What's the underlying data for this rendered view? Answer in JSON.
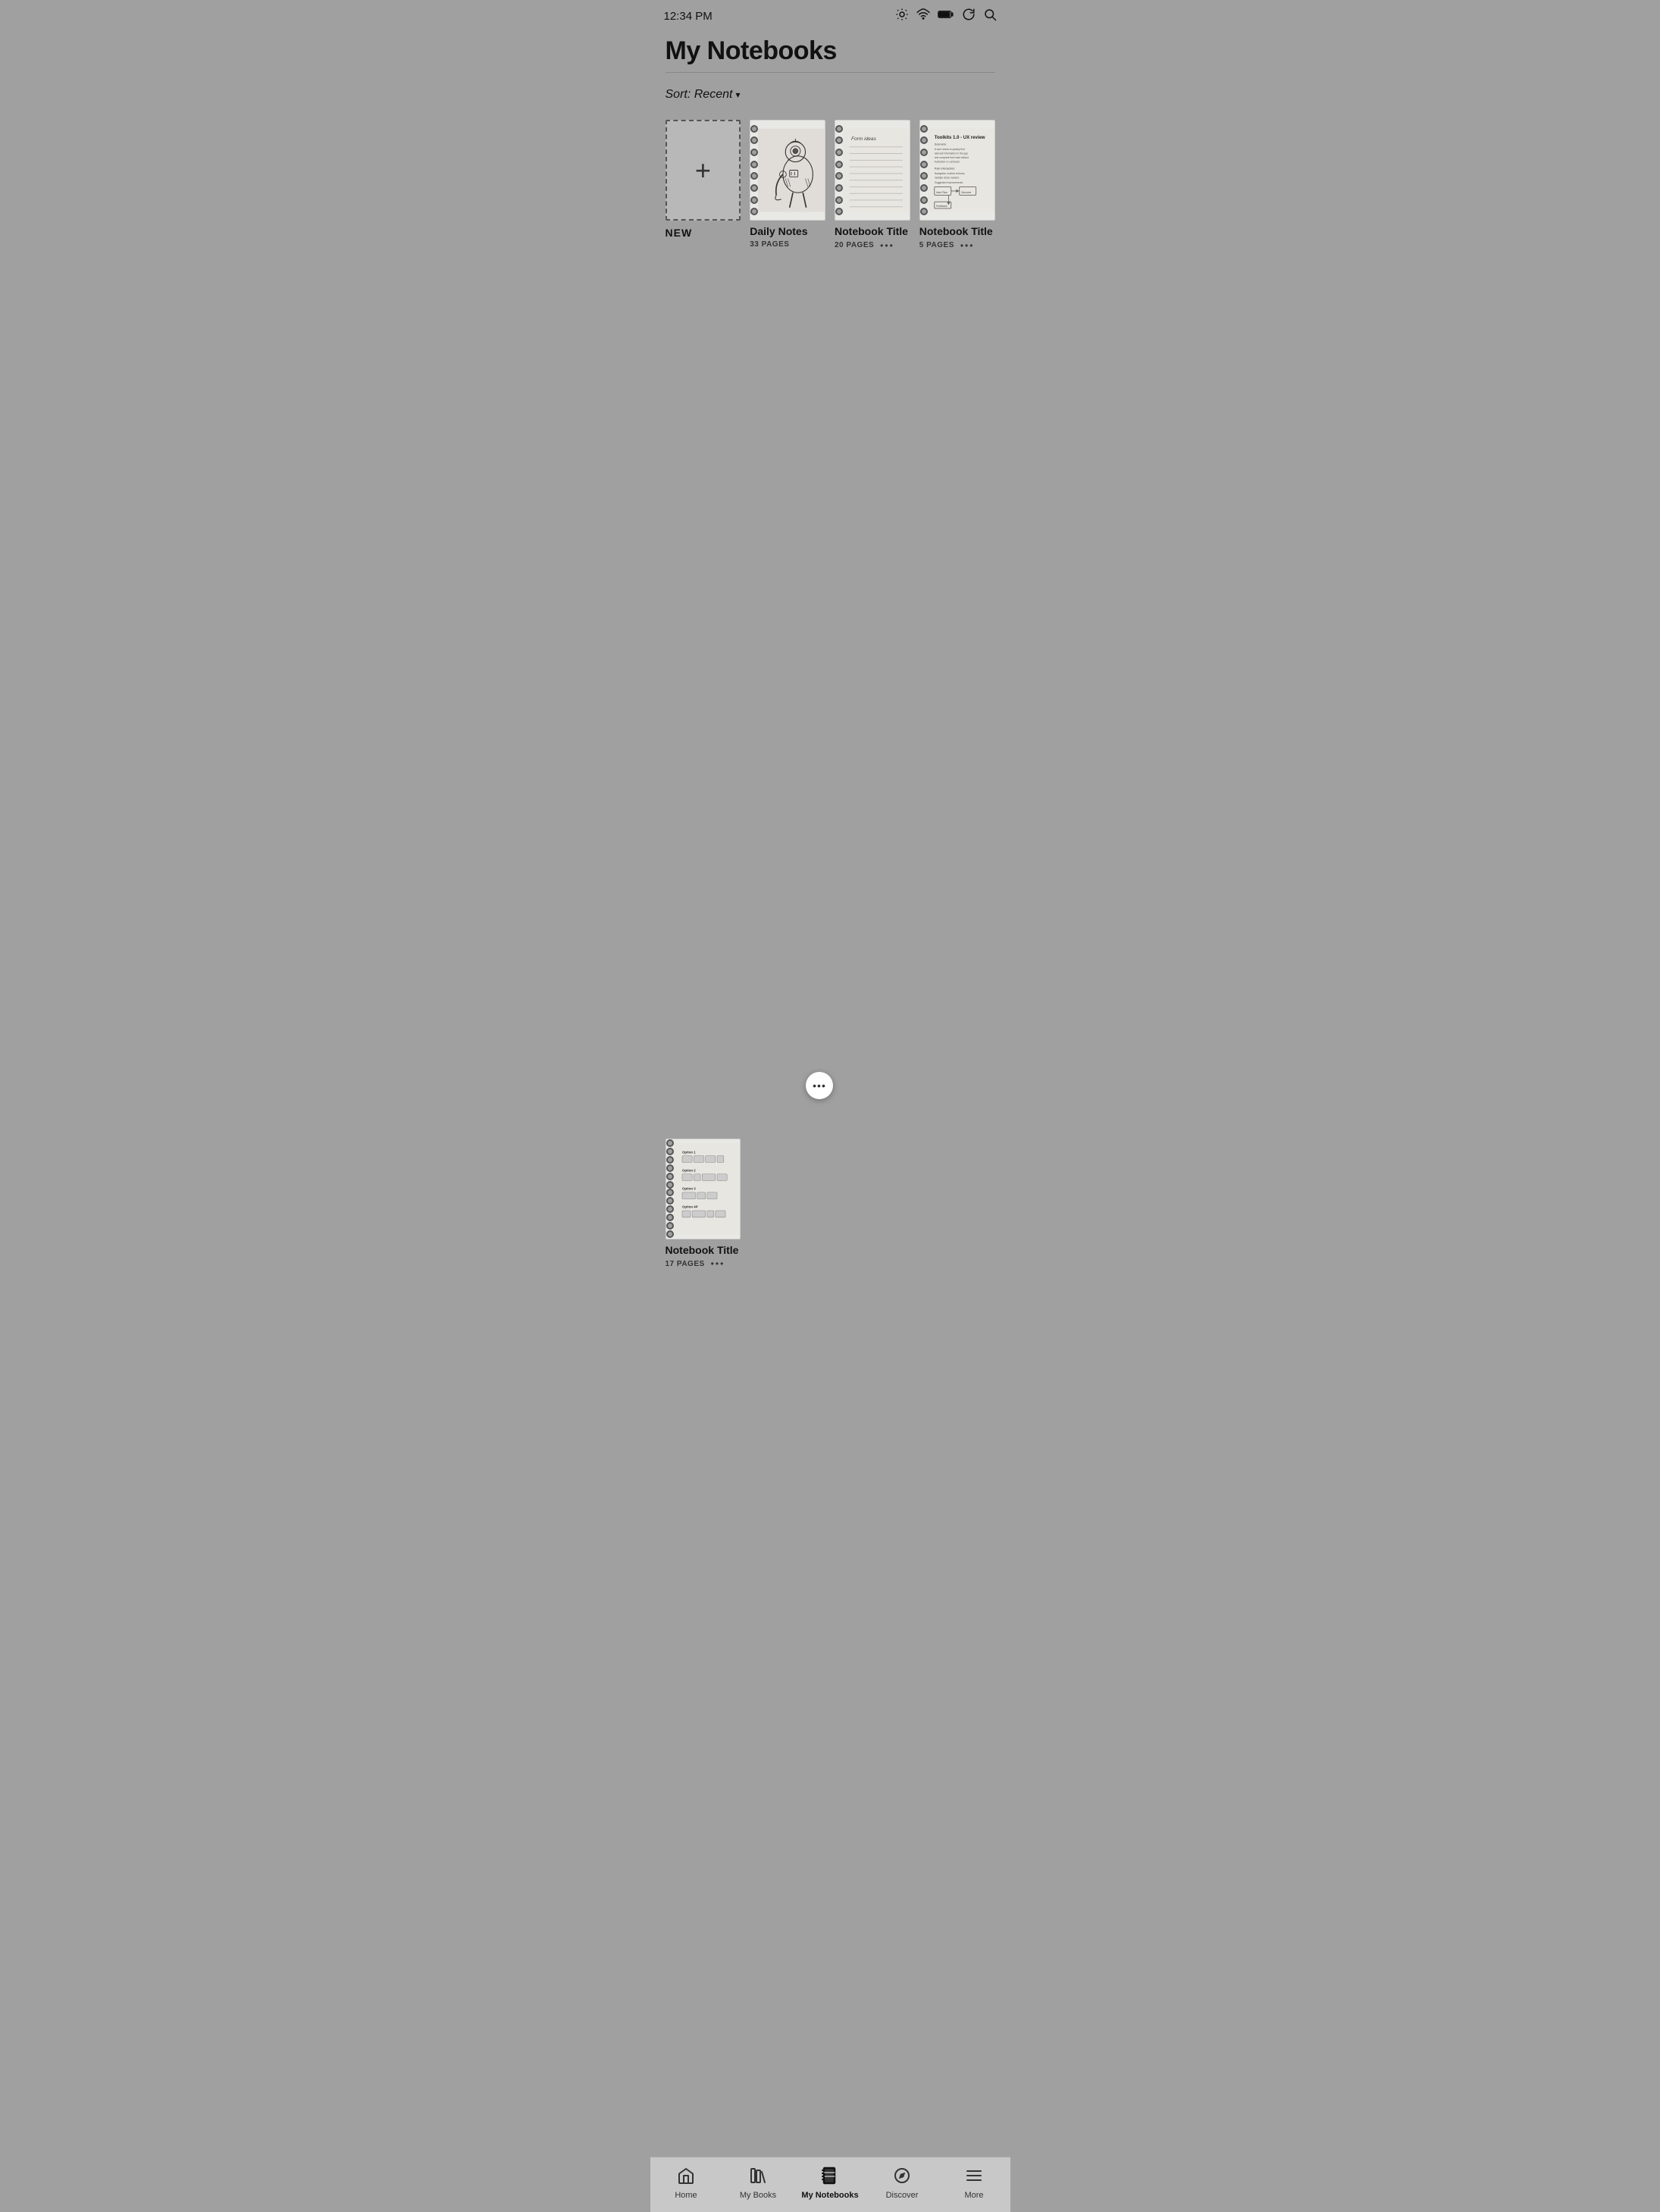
{
  "statusBar": {
    "time": "12:34 PM",
    "icons": [
      "brightness-icon",
      "wifi-icon",
      "battery-icon",
      "sync-icon",
      "search-icon"
    ]
  },
  "header": {
    "title": "My Notebooks"
  },
  "sort": {
    "label": "Sort: Recent",
    "chevron": "▾"
  },
  "notebooks": [
    {
      "id": "new",
      "type": "new",
      "label": "NEW"
    },
    {
      "id": "daily-notes",
      "type": "sketch",
      "title": "Daily Notes",
      "pages": "33 PAGES",
      "hasMore": true,
      "moreActive": true
    },
    {
      "id": "notebook-2",
      "type": "lines",
      "title": "Notebook Title",
      "pages": "20 PAGES",
      "hasMore": true,
      "moreActive": false
    },
    {
      "id": "notebook-3",
      "type": "notes",
      "title": "Notebook Title",
      "pages": "5 PAGES",
      "hasMore": true,
      "moreActive": false
    },
    {
      "id": "notebook-4",
      "type": "grid",
      "title": "Notebook Title",
      "pages": "17 PAGES",
      "hasMore": true,
      "moreActive": false
    }
  ],
  "bottomNav": {
    "items": [
      {
        "id": "home",
        "label": "Home",
        "icon": "home-icon",
        "active": false
      },
      {
        "id": "my-books",
        "label": "My Books",
        "icon": "books-icon",
        "active": false
      },
      {
        "id": "my-notebooks",
        "label": "My Notebooks",
        "icon": "notebooks-icon",
        "active": true
      },
      {
        "id": "discover",
        "label": "Discover",
        "icon": "discover-icon",
        "active": false
      },
      {
        "id": "more",
        "label": "More",
        "icon": "more-menu-icon",
        "active": false
      }
    ]
  }
}
